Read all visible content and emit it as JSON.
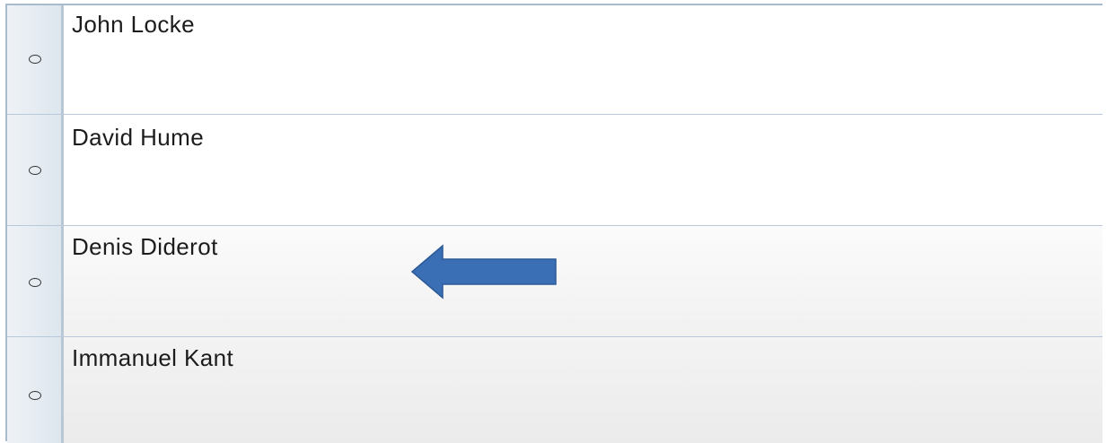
{
  "question": {
    "options": [
      {
        "label": "John Locke"
      },
      {
        "label": "David Hume"
      },
      {
        "label": "Denis Diderot"
      },
      {
        "label": "Immanuel Kant"
      }
    ],
    "pointer_color": "#3a6fb5",
    "pointer_icon": "left-arrow-icon"
  }
}
